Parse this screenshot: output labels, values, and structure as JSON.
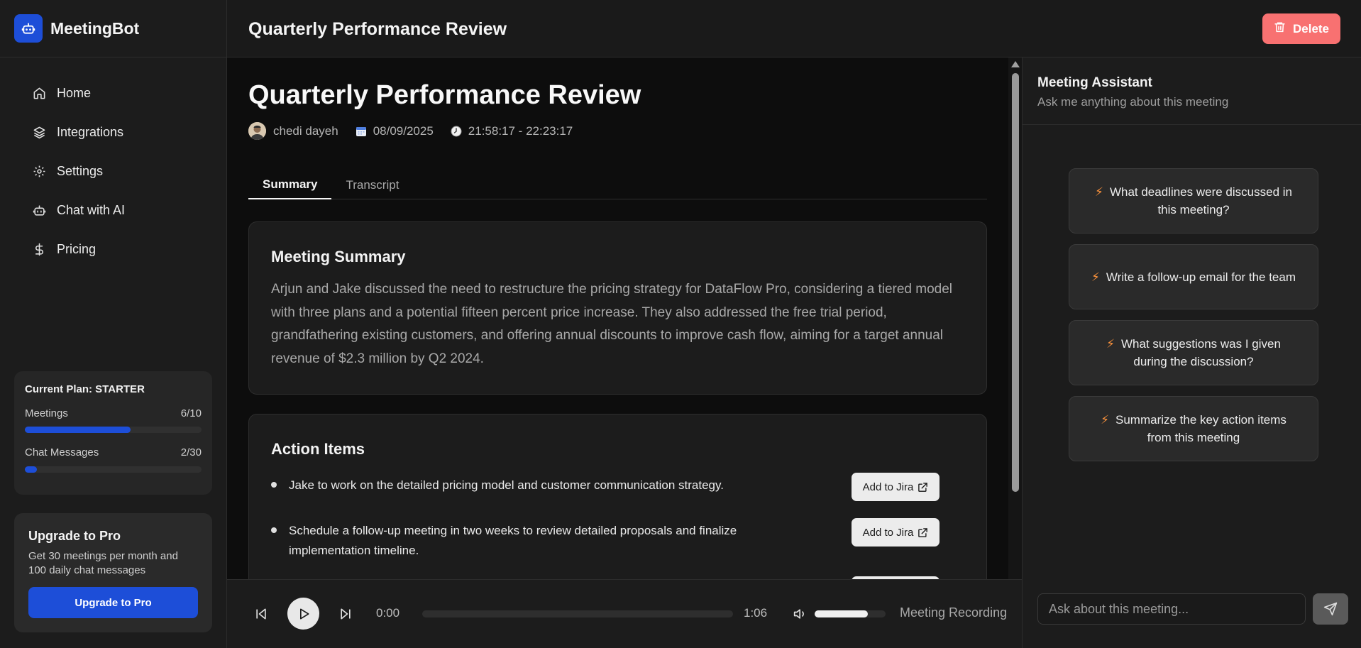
{
  "app": {
    "name": "MeetingBot"
  },
  "sidebar": {
    "items": [
      {
        "label": "Home",
        "icon": "home-icon"
      },
      {
        "label": "Integrations",
        "icon": "layers-icon"
      },
      {
        "label": "Settings",
        "icon": "gear-icon"
      },
      {
        "label": "Chat with AI",
        "icon": "bot-icon"
      },
      {
        "label": "Pricing",
        "icon": "dollar-icon"
      }
    ],
    "plan": {
      "title": "Current Plan: STARTER",
      "meetings_label": "Meetings",
      "meetings_value": "6/10",
      "meetings_progress": 0.6,
      "chat_label": "Chat Messages",
      "chat_value": "2/30",
      "chat_progress": 0.067
    },
    "upgrade": {
      "title": "Upgrade to Pro",
      "text": "Get 30 meetings per month and 100 daily chat messages",
      "button": "Upgrade to Pro"
    }
  },
  "header": {
    "title": "Quarterly Performance Review",
    "delete_label": "Delete"
  },
  "meeting": {
    "title": "Quarterly Performance Review",
    "author": "chedi dayeh",
    "date": "08/09/2025",
    "time": "21:58:17 - 22:23:17",
    "tabs": [
      "Summary",
      "Transcript"
    ],
    "active_tab": "Summary"
  },
  "summary": {
    "title": "Meeting Summary",
    "text": "Arjun and Jake discussed the need to restructure the pricing strategy for DataFlow Pro, considering a tiered model with three plans and a potential fifteen percent price increase. They also addressed the free trial period, grandfathering existing customers, and offering annual discounts to improve cash flow, aiming for a target annual revenue of $2.3 million by Q2 2024."
  },
  "actions": {
    "title": "Action Items",
    "jira_label": "Add to Jira",
    "items": [
      "Jake to work on the detailed pricing model and customer communication strategy.",
      "Schedule a follow-up meeting in two weeks to review detailed proposals and finalize implementation timeline."
    ]
  },
  "player": {
    "current_time": "0:00",
    "duration": "1:06",
    "progress": 0,
    "volume": 0.75,
    "label": "Meeting Recording"
  },
  "assistant": {
    "title": "Meeting Assistant",
    "subtitle": "Ask me anything about this meeting",
    "suggestions": [
      "What deadlines were discussed in this meeting?",
      "Write a follow-up email for the team",
      "What suggestions was I given during the discussion?",
      "Summarize the key action items from this meeting"
    ],
    "input_placeholder": "Ask about this meeting..."
  },
  "colors": {
    "accent": "#1d4ed8",
    "danger": "#f87171",
    "bolt": "#fb923c"
  }
}
